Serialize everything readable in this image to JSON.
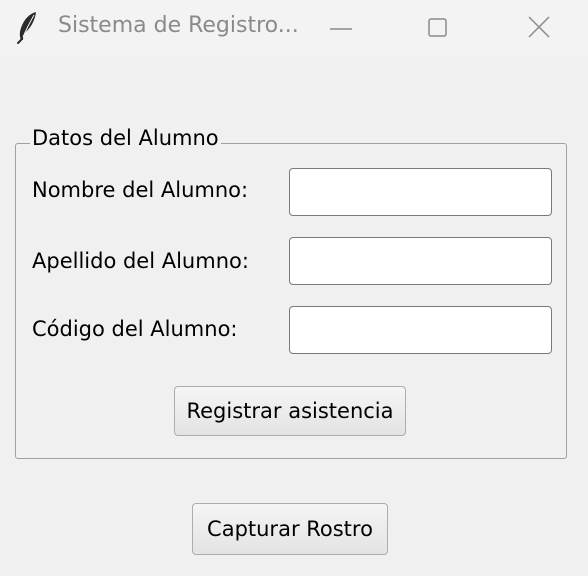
{
  "window": {
    "title": "Sistema de Registro...",
    "icon": "feather-icon",
    "controls": [
      "minimize-icon",
      "maximize-icon",
      "close-icon"
    ]
  },
  "group": {
    "legend": "Datos del Alumno",
    "fields": [
      {
        "label": "Nombre del Alumno:",
        "value": "",
        "placeholder": ""
      },
      {
        "label": "Apellido del Alumno:",
        "value": "",
        "placeholder": ""
      },
      {
        "label": "Código del Alumno:",
        "value": "",
        "placeholder": ""
      }
    ],
    "register_button": "Registrar asistencia"
  },
  "capture_button": "Capturar Rostro"
}
